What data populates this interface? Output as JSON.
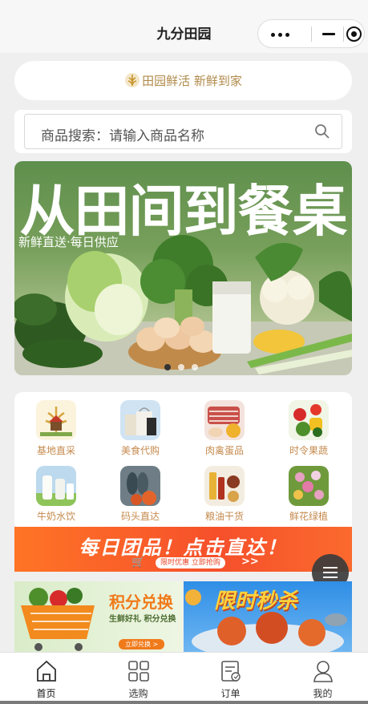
{
  "app": {
    "title": "九分田园"
  },
  "slogan": {
    "text": "田园鲜活 新鲜到家"
  },
  "search": {
    "placeholder": "商品搜索：请输入商品名称"
  },
  "banner": {
    "headline": "从田间到餐桌",
    "subline": "新鲜直送·每日供应",
    "dots": 3,
    "active_dot": 1
  },
  "categories": [
    {
      "label": "基地直采",
      "icon": "farm-icon"
    },
    {
      "label": "美食代购",
      "icon": "shopping-bag-icon"
    },
    {
      "label": "肉禽蛋品",
      "icon": "meat-icon"
    },
    {
      "label": "时令果蔬",
      "icon": "vegetables-icon"
    },
    {
      "label": "牛奶水饮",
      "icon": "milk-icon"
    },
    {
      "label": "码头直达",
      "icon": "seafood-icon"
    },
    {
      "label": "粮油干货",
      "icon": "grain-oil-icon"
    },
    {
      "label": "鲜花绿植",
      "icon": "flower-icon"
    }
  ],
  "promo": {
    "headline": "每日团品！点击直达！",
    "pill": "限时优惠 立即抢购",
    "arrows": ">>"
  },
  "tiles": {
    "points": {
      "title": "积分兑换",
      "subtitle": "生鲜好礼 积分兑换",
      "button": "立即兑换 >"
    },
    "flash": {
      "title": "限时秒杀"
    }
  },
  "tabbar": [
    {
      "label": "首页",
      "icon": "home-icon",
      "active": true
    },
    {
      "label": "选购",
      "icon": "grid-icon",
      "active": false
    },
    {
      "label": "订单",
      "icon": "order-icon",
      "active": false
    },
    {
      "label": "我的",
      "icon": "user-icon",
      "active": false
    }
  ],
  "colors": {
    "accent_gold": "#b08a4a",
    "category_label": "#c58a4e",
    "promo_orange": "#f6502b"
  }
}
